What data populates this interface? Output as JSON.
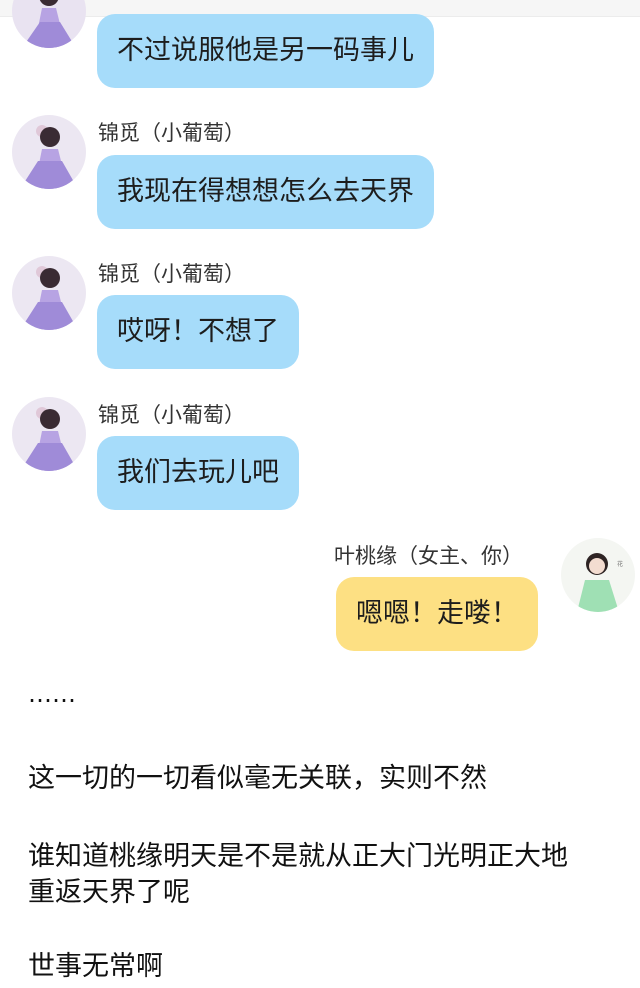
{
  "chat": {
    "messages": [
      {
        "sender": "",
        "text": "不过说服他是另一码事儿"
      },
      {
        "sender": "锦觅（小葡萄）",
        "text": "我现在得想想怎么去天界"
      },
      {
        "sender": "锦觅（小葡萄）",
        "text": "哎呀！不想了"
      },
      {
        "sender": "锦觅（小葡萄）",
        "text": "我们去玩儿吧"
      },
      {
        "sender": "叶桃缘（女主、你）",
        "text": "嗯嗯！走喽！"
      }
    ]
  },
  "article": {
    "ellipsis": "……",
    "line1": "这一切的一切看似毫无关联，实则不然",
    "line2a": "谁知道桃缘明天是不是就从正大门光明正大地",
    "line2b": "重返天界了呢",
    "line3": "世事无常啊"
  },
  "colors": {
    "left_bubble": "#a6dcfa",
    "right_bubble": "#fde083"
  },
  "icons": [
    "avatar-jinmi",
    "avatar-yetaoyuan"
  ]
}
